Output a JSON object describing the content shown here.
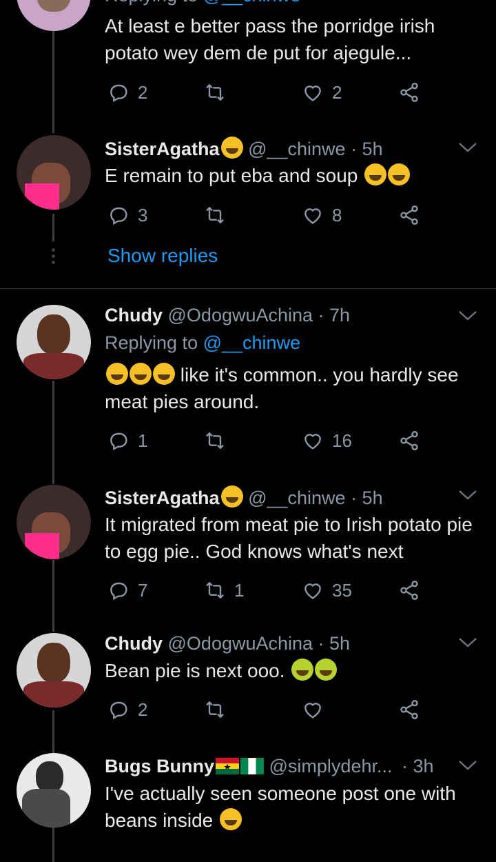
{
  "tweets": [
    {
      "partial": true,
      "text": "At least e better pass the porridge irish potato wey dem de put for ajegule...",
      "replies": "2",
      "retweets": "",
      "likes": "2"
    },
    {
      "name": "SisterAgatha",
      "handle": "@__chinwe · 5h",
      "text": "E remain to put eba and soup",
      "replies": "3",
      "retweets": "",
      "likes": "8"
    },
    {
      "name": "Chudy",
      "handle": "@OdogwuAchina · 7h",
      "replying_prefix": "Replying to ",
      "replying_handle": "@__chinwe",
      "text": "like it's common.. you hardly see meat pies around.",
      "replies": "1",
      "retweets": "",
      "likes": "16"
    },
    {
      "name": "SisterAgatha",
      "handle": "@__chinwe · 5h",
      "text": "It migrated from meat pie to Irish potato pie to egg pie.. God knows what's next",
      "replies": "7",
      "retweets": "1",
      "likes": "35"
    },
    {
      "name": "Chudy",
      "handle": "@OdogwuAchina · 5h",
      "text": "Bean pie is next ooo.",
      "replies": "2",
      "retweets": "",
      "likes": ""
    },
    {
      "name": "Bugs Bunny",
      "handle": "@simplydehr...",
      "time": "· 3h",
      "text": "I've actually seen someone post one with beans inside",
      "replies": "",
      "retweets": "",
      "likes": ""
    }
  ],
  "show_replies": "Show replies",
  "icons": {
    "reply": "reply-icon",
    "retweet": "retweet-icon",
    "like": "heart-icon",
    "share": "share-icon",
    "more": "chevron-down-icon"
  },
  "colors": {
    "background": "#000000",
    "link": "#1d9bf0",
    "muted": "#8b98a5"
  }
}
